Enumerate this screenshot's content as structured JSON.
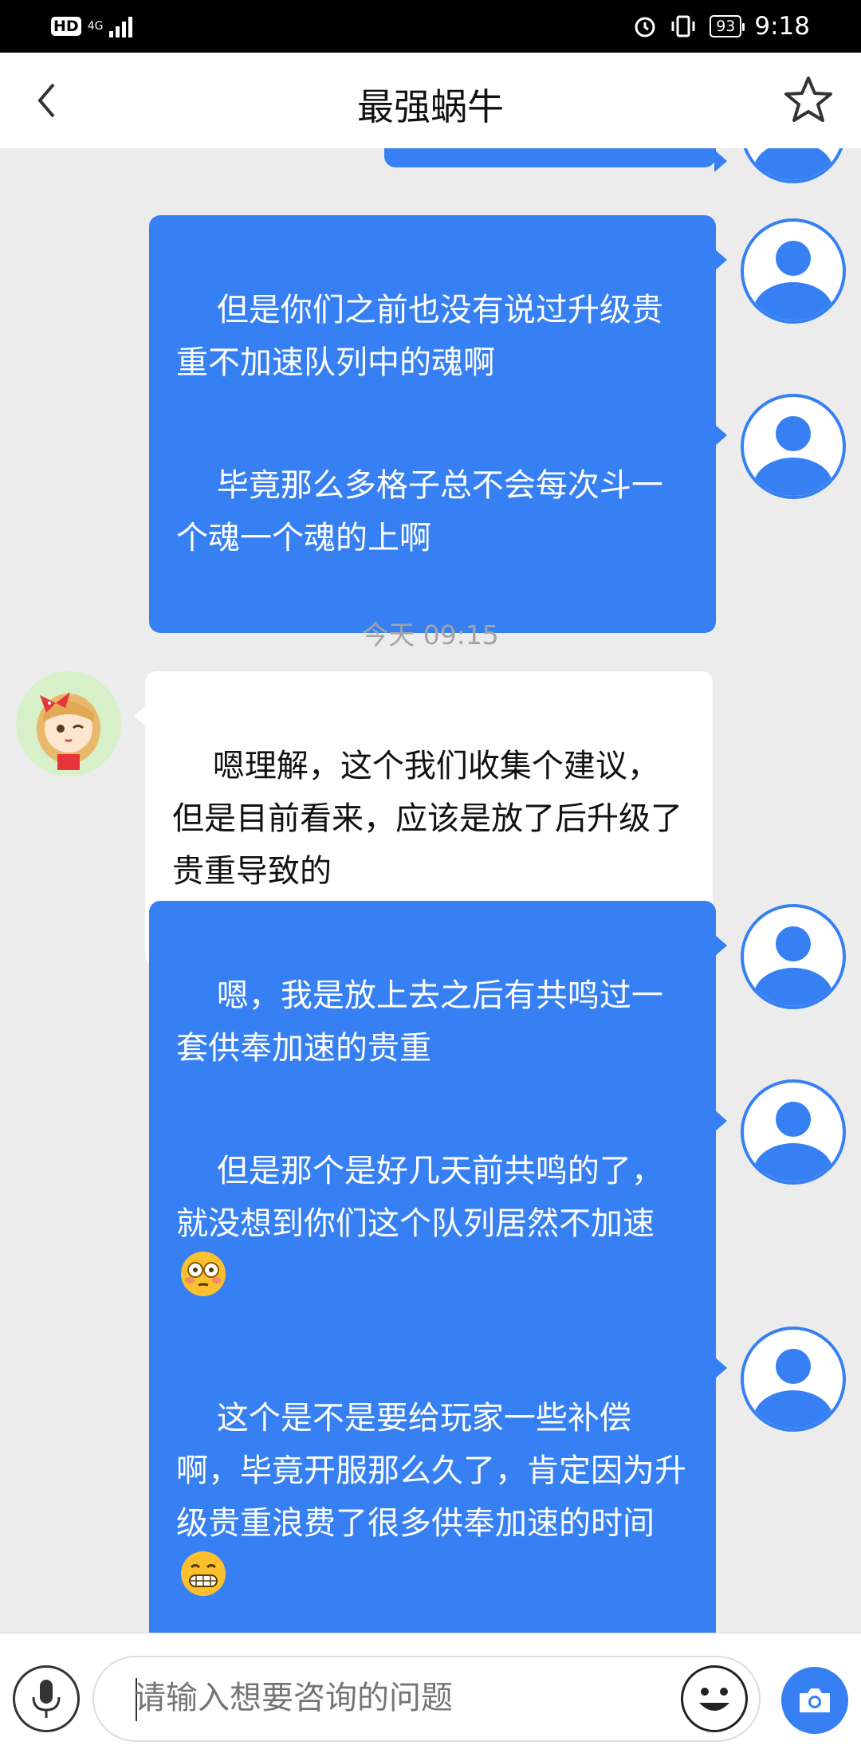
{
  "status_bar": {
    "hd": "HD",
    "network": "4G",
    "battery": "93",
    "time": "9:18"
  },
  "header": {
    "title": "最强蜗牛"
  },
  "messages": [
    {
      "from": "user",
      "text": ""
    },
    {
      "from": "user",
      "text": "但是你们之前也没有说过升级贵重不加速队列中的魂啊"
    },
    {
      "from": "user",
      "text": "毕竟那么多格子总不会每次斗一个魂一个魂的上啊"
    },
    {
      "timestamp": "今天 09:15"
    },
    {
      "from": "agent",
      "text": "嗯理解，这个我们收集个建议，但是目前看来，应该是放了后升级了贵重导致的"
    },
    {
      "from": "user",
      "text": "嗯，我是放上去之后有共鸣过一套供奉加速的贵重"
    },
    {
      "from": "user",
      "text": "但是那个是好几天前共鸣的了，就没想到你们这个队列居然不加速",
      "emoji": "flushed-face"
    },
    {
      "from": "user",
      "text": "这个是不是要给玩家一些补偿啊，毕竟开服那么久了，肯定因为升级贵重浪费了很多供奉加速的时间",
      "emoji": "grinning-teeth-face"
    }
  ],
  "input": {
    "placeholder": "请输入想要咨询的问题"
  },
  "colors": {
    "accent": "#3680f3",
    "background": "#ececec",
    "timestamp": "#a4a4a4"
  },
  "icons": [
    "back-chevron-icon",
    "star-icon",
    "microphone-icon",
    "smiley-icon",
    "camera-icon",
    "default-user-avatar",
    "agent-cartoon-avatar"
  ]
}
